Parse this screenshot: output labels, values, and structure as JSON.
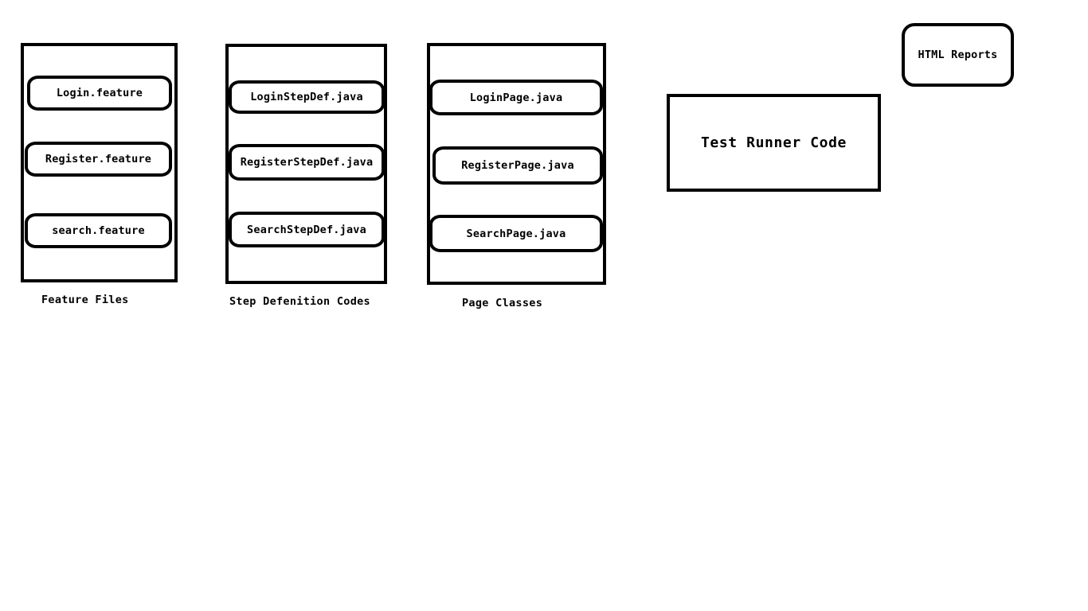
{
  "feature_files": {
    "caption": "Feature Files",
    "items": [
      "Login.feature",
      "Register.feature",
      "search.feature"
    ]
  },
  "step_definitions": {
    "caption": "Step Defenition Codes",
    "items": [
      "LoginStepDef.java",
      "RegisterStepDef.java",
      "SearchStepDef.java"
    ]
  },
  "page_classes": {
    "caption": "Page Classes",
    "items": [
      "LoginPage.java",
      "RegisterPage.java",
      "SearchPage.java"
    ]
  },
  "test_runner": {
    "label": "Test Runner Code"
  },
  "html_reports": {
    "label": "HTML Reports"
  }
}
